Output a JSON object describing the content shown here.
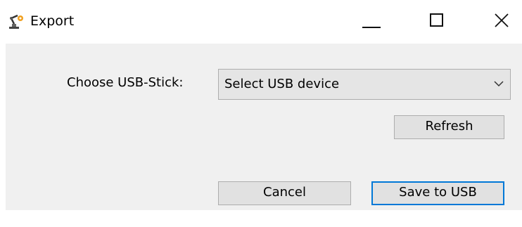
{
  "window": {
    "title": "Export",
    "app_icon": "robot-arm-icon",
    "controls": {
      "minimize_icon": "minimize-icon",
      "maximize_icon": "maximize-icon",
      "close_icon": "close-icon"
    }
  },
  "form": {
    "usb_label": "Choose USB-Stick:",
    "usb_select": {
      "selected": "Select USB device",
      "dropdown_icon": "chevron-down-icon"
    },
    "refresh_label": "Refresh"
  },
  "footer": {
    "cancel_label": "Cancel",
    "save_label": "Save to USB"
  },
  "colors": {
    "client_background": "#f0f0f0",
    "button_background": "#e1e1e1",
    "focus_border": "#0078d7"
  }
}
